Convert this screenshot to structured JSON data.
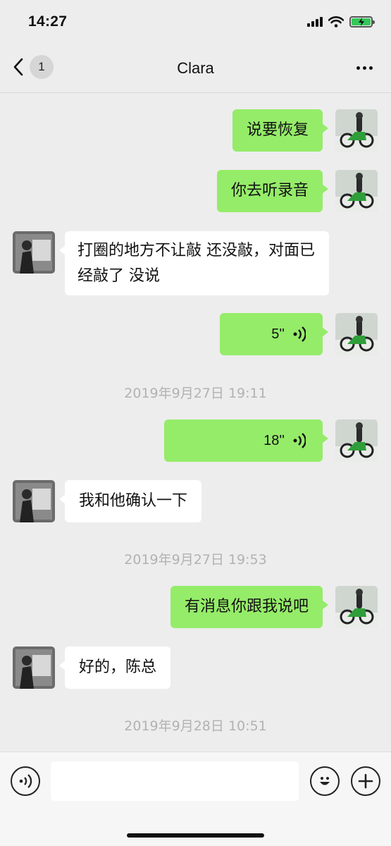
{
  "status_bar": {
    "time": "14:27"
  },
  "nav": {
    "back_count": "1",
    "title": "Clara"
  },
  "messages": [
    {
      "side": "right",
      "text": "说要恢复"
    },
    {
      "side": "right",
      "text": "你去听录音"
    },
    {
      "side": "left",
      "text": "打圈的地方不让敲 还没敲，对面已经敲了 没说"
    },
    {
      "side": "right",
      "type": "voice",
      "duration": "5''"
    },
    {
      "type": "time",
      "text": "2019年9月27日 19:11"
    },
    {
      "side": "right",
      "type": "voice",
      "duration": "18''"
    },
    {
      "side": "left",
      "text": "我和他确认一下"
    },
    {
      "type": "time",
      "text": "2019年9月27日 19:53"
    },
    {
      "side": "right",
      "text": "有消息你跟我说吧"
    },
    {
      "side": "left",
      "text": "好的，陈总"
    },
    {
      "type": "time",
      "text": "2019年9月28日 10:51"
    }
  ],
  "input": {
    "value": "",
    "placeholder": ""
  },
  "icons": {
    "back": "chevron-left-icon",
    "more": "more-dots-icon",
    "voice_toggle": "voice-icon",
    "emoji": "emoji-icon",
    "add": "plus-icon"
  }
}
